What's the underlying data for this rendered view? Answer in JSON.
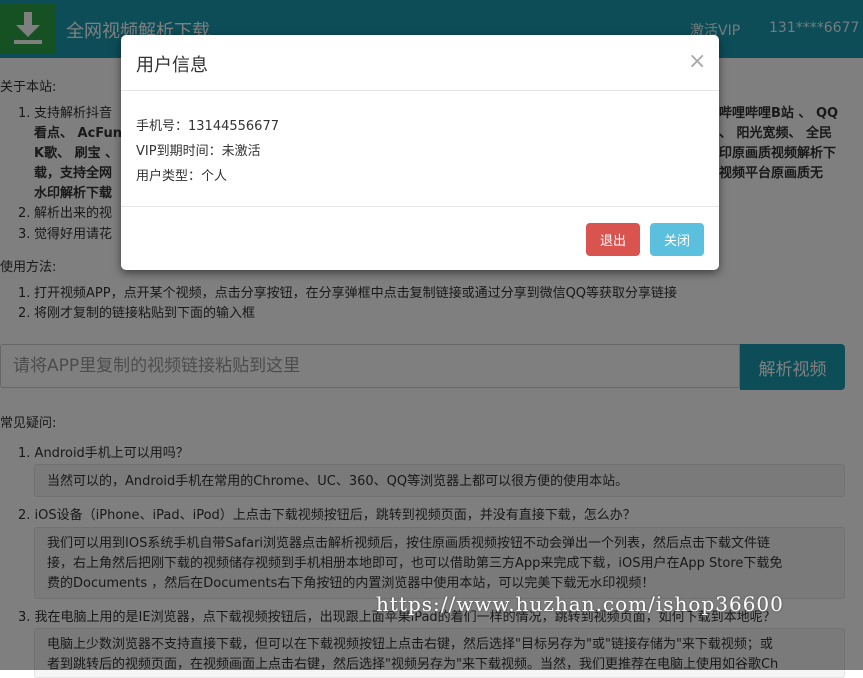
{
  "header": {
    "title": "全网视频解析下载",
    "vip_label": "激活VIP",
    "phone_masked": "131****6677"
  },
  "about": {
    "title": "关于本站:",
    "item1_lines": [
      "支持解析抖音",
      "看点、 AcFun",
      "K歌、 刷宝 、",
      "载，支持全网",
      "水印解析下载"
    ],
    "item1_right_lines": [
      "哔哩哔哩B站 、 QQ",
      "、 阳光宽频、 全民",
      "印原画质视频解析下",
      "视频平台原画质无"
    ],
    "item2": "解析出来的视",
    "item3": "觉得好用请花"
  },
  "usage": {
    "title": "使用方法:",
    "steps": [
      "打开视频APP，点开某个视频，点击分享按钮，在分享弹框中点击复制链接或通过分享到微信QQ等获取分享链接",
      "将刚才复制的链接粘贴到下面的输入框"
    ]
  },
  "search": {
    "placeholder": "请将APP里复制的视频链接粘贴到这里",
    "button_label": "解析视频"
  },
  "faq": {
    "title": "常见疑问:",
    "items": [
      {
        "q": "Android手机上可以用吗？",
        "a_lines": [
          "当然可以的，Android手机在常用的Chrome、UC、360、QQ等浏览器上都可以很方便的使用本站。"
        ]
      },
      {
        "q": "iOS设备（iPhone、iPad、iPod）上点击下载视频按钮后，跳转到视频页面，并没有直接下载，怎么办？",
        "a_lines": [
          "我们可以用到IOS系统手机自带Safari浏览器点击解析视频后，按住原画质视频按钮不动会弹出一个列表，然后点击下载文件链",
          "接，右上角然后把刚下载的视频储存视频到手机相册本地即可，也可以借助第三方App来完成下载，iOS用户在App Store下载免",
          "费的Documents ，然后在Documents右下角按钮的内置浏览器中使用本站，可以完美下载无水印视频！"
        ]
      },
      {
        "q": "我在电脑上用的是IE浏览器，点下载视频按钮后，出现跟上面苹果iPad的着们一样的情况，跳转到视频页面，如何下载到本地呢？",
        "a_lines": [
          "电脑上少数浏览器不支持直接下载，但可以在下载视频按钮上点击右键，然后选择\"目标另存为\"或\"链接存储为\"来下载视频；或",
          "者到跳转后的视频页面，在视频画面上点击右键，然后选择\"视频另存为\"来下载视频。当然，我们更推荐在电脑上使用如谷歌Ch"
        ]
      }
    ]
  },
  "watermark": "https://www.huzhan.com/ishop36600",
  "modal": {
    "title": "用户信息",
    "close_symbol": "×",
    "phone_line": "手机号：13144556677",
    "vip_line": "VIP到期时间：未激活",
    "type_line": "用户类型：个人",
    "logout_label": "退出",
    "close_label": "关闭"
  },
  "colors": {
    "header_bg": "#1b9bb0",
    "logo_bg": "#2aa244",
    "danger": "#d9534f",
    "info": "#5bc0de"
  }
}
